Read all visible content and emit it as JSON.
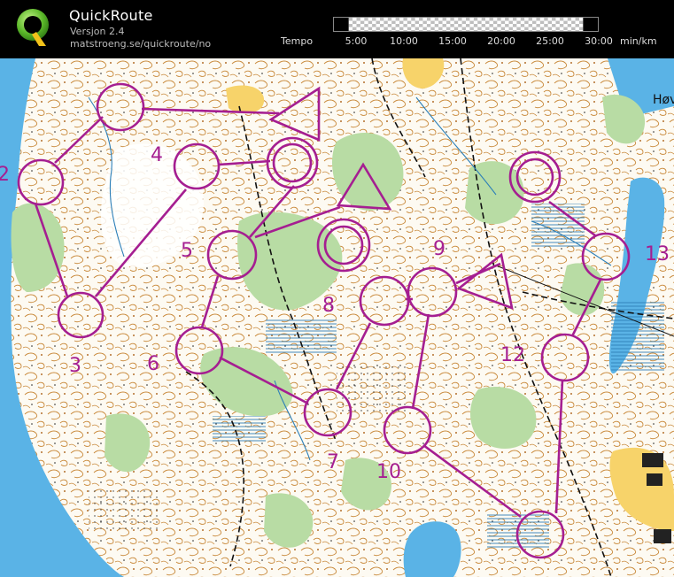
{
  "header": {
    "title": "QuickRoute",
    "version": "Versjon 2.4",
    "url": "matstroeng.se/quickroute/no",
    "logo_letter": "Q"
  },
  "tempo": {
    "label": "Tempo",
    "ticks": [
      "5:00",
      "10:00",
      "15:00",
      "20:00",
      "25:00",
      "30:00"
    ],
    "unit": "min/km"
  },
  "map": {
    "place_label": "Høv",
    "course_color": "#a51e91",
    "controls": [
      {
        "label": "2"
      },
      {
        "label": "3"
      },
      {
        "label": "4"
      },
      {
        "label": "5"
      },
      {
        "label": "6"
      },
      {
        "label": "7"
      },
      {
        "label": "8"
      },
      {
        "label": "9"
      },
      {
        "label": "10"
      },
      {
        "label": "12"
      },
      {
        "label": "13"
      }
    ]
  }
}
